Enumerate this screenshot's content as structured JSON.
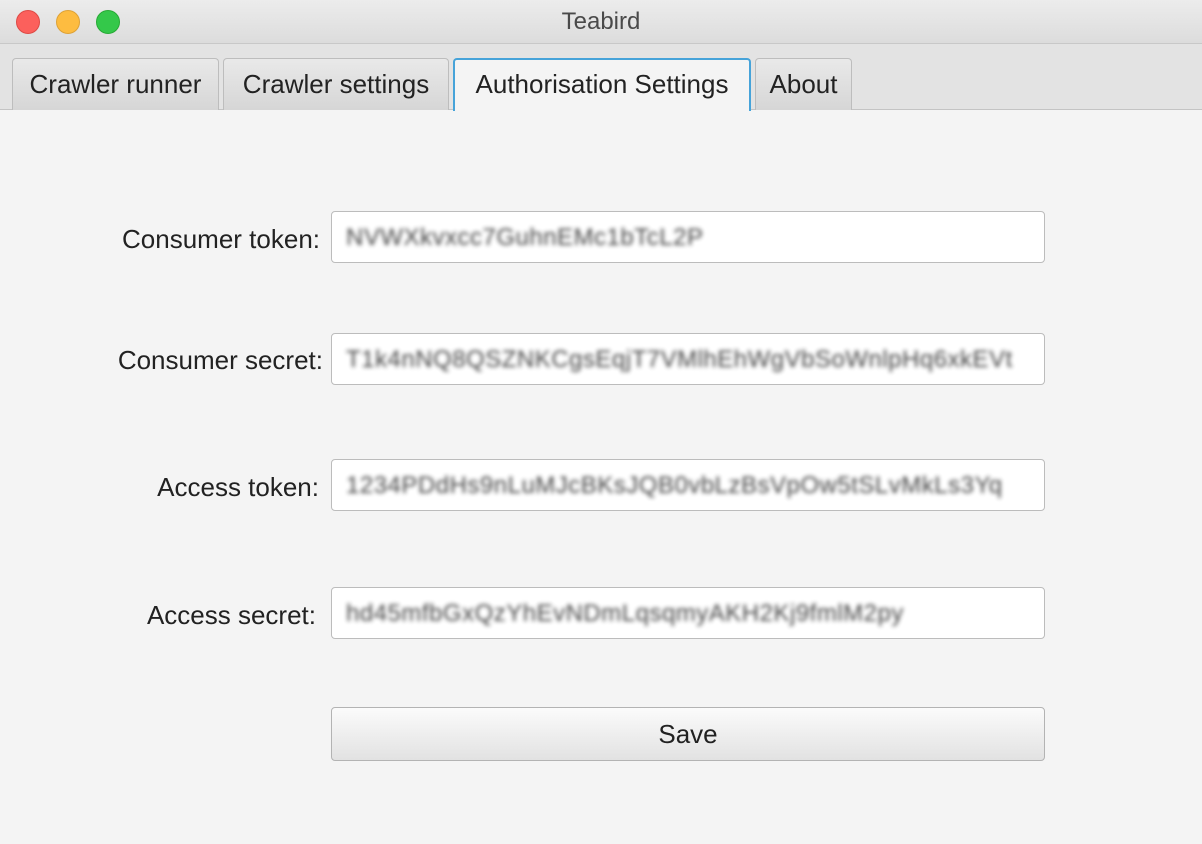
{
  "window": {
    "title": "Teabird"
  },
  "tabs": [
    {
      "label": "Crawler runner"
    },
    {
      "label": "Crawler settings"
    },
    {
      "label": "Authorisation Settings",
      "active": true
    },
    {
      "label": "About"
    }
  ],
  "form": {
    "consumer_token": {
      "label": "Consumer token:",
      "value": "NVWXkvxcc7GuhnEMc1bTcL2P"
    },
    "consumer_secret": {
      "label": "Consumer secret:",
      "value": "T1k4nNQ8QSZNKCgsEqjT7VMlhEhWgVbSoWnlpHq6xkEVt"
    },
    "access_token": {
      "label": "Access token:",
      "value": "1234PDdHs9nLuMJcBKsJQB0vbLzBsVpOw5tSLvMkLs3Yq"
    },
    "access_secret": {
      "label": "Access secret:",
      "value": "hd45mfbGxQzYhEvNDmLqsqmyAKH2Kj9fmlM2py"
    }
  },
  "save_button": {
    "label": "Save"
  }
}
